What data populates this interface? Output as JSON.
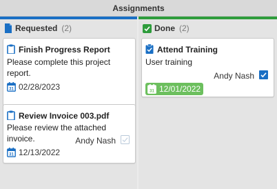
{
  "header": {
    "title": "Assignments"
  },
  "columns": [
    {
      "title": "Requested",
      "count": "(2)",
      "icon": "document-icon",
      "color": "#1a6fc4",
      "cards": [
        {
          "title": "Finish Progress Report",
          "description_lines": [
            "Please complete this project",
            "report."
          ],
          "date": "02/28/2023"
        },
        {
          "title": "Review Invoice 003.pdf",
          "description_lines": [
            "Please review the attached invoice."
          ],
          "assignee": "Andy Nash",
          "checked": false,
          "date": "12/13/2022"
        }
      ]
    },
    {
      "title": "Done",
      "count": "(2)",
      "icon": "checkbox-checked-icon",
      "color": "#2e9c3c",
      "cards": [
        {
          "title": "Attend Training",
          "description_lines": [
            "User training"
          ],
          "assignee": "Andy Nash",
          "checked": true,
          "date": "12/01/2022",
          "date_badge_color": "#6cbf5e"
        }
      ]
    }
  ]
}
